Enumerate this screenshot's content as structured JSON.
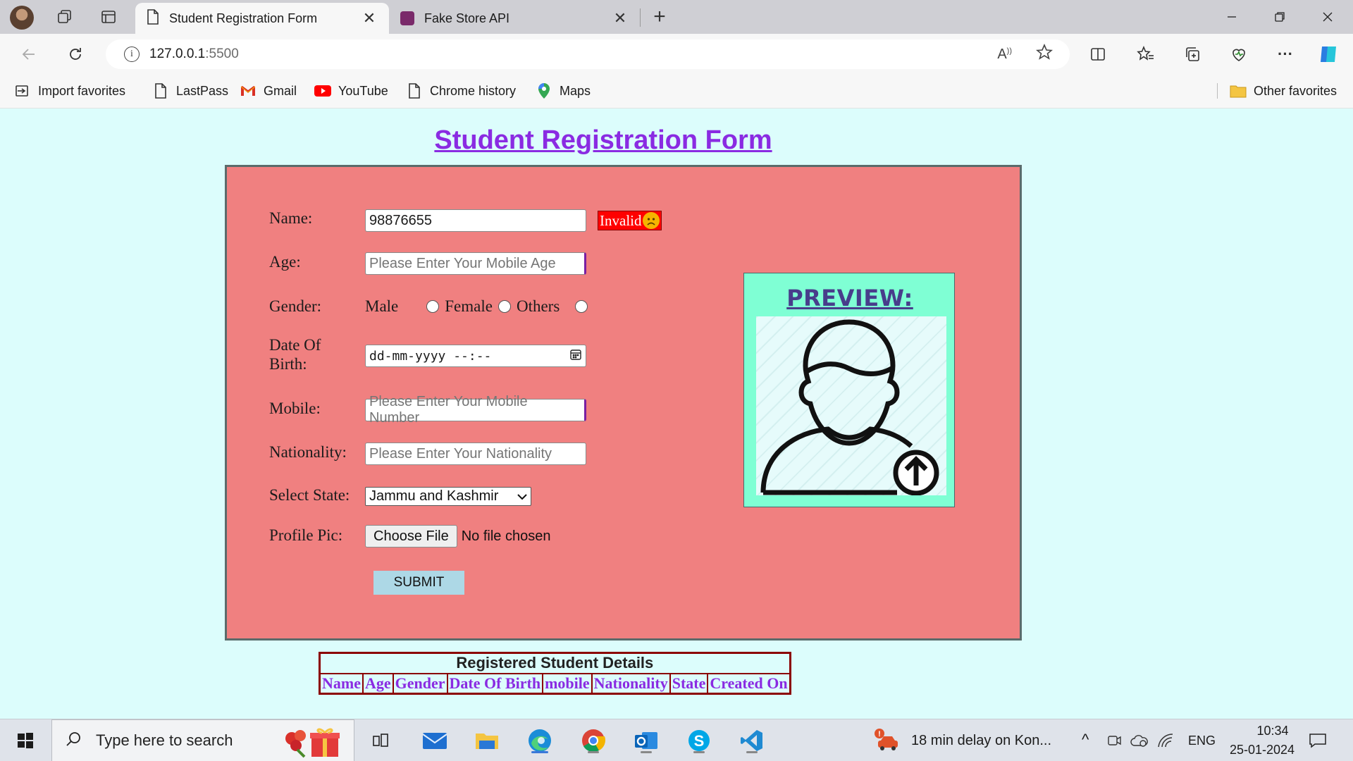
{
  "browser": {
    "tabs": [
      {
        "title": "Student Registration Form",
        "active": true
      },
      {
        "title": "Fake Store API",
        "active": false
      }
    ],
    "url_host": "127.0.0.1",
    "url_port": ":5500",
    "bookmarks": [
      {
        "label": "Import favorites",
        "icon": "import-icon"
      },
      {
        "label": "LastPass",
        "icon": "page-icon"
      },
      {
        "label": "Gmail",
        "icon": "gmail-icon"
      },
      {
        "label": "YouTube",
        "icon": "youtube-icon"
      },
      {
        "label": "Chrome history",
        "icon": "page-icon"
      },
      {
        "label": "Maps",
        "icon": "maps-icon"
      }
    ],
    "other_favorites": "Other favorites"
  },
  "page": {
    "title": "Student Registration Form",
    "form": {
      "name_label": "Name:",
      "name_value": "98876655",
      "invalid_text": "Invalid",
      "age_label": "Age:",
      "age_placeholder": "Please Enter Your Mobile Age",
      "gender_label": "Gender:",
      "gender_options": [
        "Male",
        "Female",
        "Others"
      ],
      "dob_label_1": "Date Of",
      "dob_label_2": "Birth:",
      "dob_placeholder": "dd-mm-yyyy --:--",
      "mobile_label": "Mobile:",
      "mobile_placeholder": "Please Enter Your Mobile Number",
      "nationality_label": "Nationality:",
      "nationality_placeholder": "Please Enter Your Nationality",
      "state_label": "Select State:",
      "state_value": "Jammu and Kashmir",
      "profile_label": "Profile Pic:",
      "choose_file": "Choose File",
      "no_file": "No file chosen",
      "submit": "SUBMIT"
    },
    "preview_title": "PREVIEW:",
    "table": {
      "caption": "Registered Student Details",
      "headers": [
        "Name",
        "Age",
        "Gender",
        "Date Of Birth",
        "mobile",
        "Nationality",
        "State",
        "Created On"
      ]
    }
  },
  "taskbar": {
    "search_placeholder": "Type here to search",
    "news": "18 min delay on Kon...",
    "lang": "ENG",
    "time": "10:34",
    "date": "25-01-2024"
  },
  "colors": {
    "page_bg": "#dcfdfc",
    "form_bg": "#f08080",
    "title_color": "#8a2be2",
    "preview_bg": "#7fffd4",
    "submit_bg": "#add8e6",
    "invalid_bg": "#ff0000"
  }
}
